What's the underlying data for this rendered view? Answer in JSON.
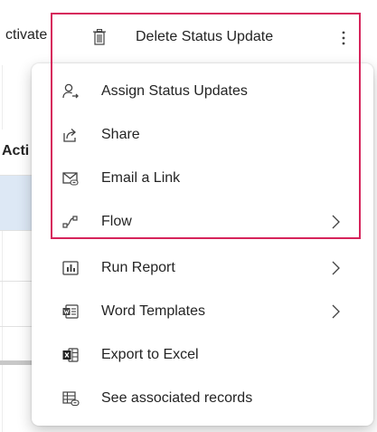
{
  "command_bar": {
    "activate_label": "ctivate",
    "delete_label": "Delete Status Update",
    "more_icon": "more-vertical-icon",
    "delete_icon": "trash-icon"
  },
  "background": {
    "column_header": "Acti"
  },
  "menu": {
    "items": [
      {
        "label": "Assign Status Updates",
        "icon": "person-arrow-icon",
        "has_submenu": false
      },
      {
        "label": "Share",
        "icon": "share-icon",
        "has_submenu": false
      },
      {
        "label": "Email a Link",
        "icon": "email-link-icon",
        "has_submenu": false
      },
      {
        "label": "Flow",
        "icon": "flow-icon",
        "has_submenu": true
      },
      {
        "label": "Run Report",
        "icon": "report-icon",
        "has_submenu": true
      },
      {
        "label": "Word Templates",
        "icon": "word-icon",
        "has_submenu": true
      },
      {
        "label": "Export to Excel",
        "icon": "excel-icon",
        "has_submenu": false
      },
      {
        "label": "See associated records",
        "icon": "associated-records-icon",
        "has_submenu": false
      }
    ]
  },
  "colors": {
    "highlight": "#d6245b",
    "text": "#242424",
    "selected_row": "#dde8f5"
  }
}
